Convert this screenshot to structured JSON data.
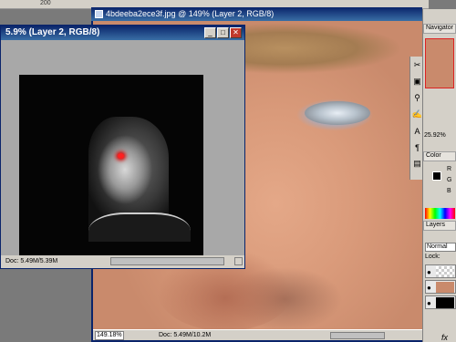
{
  "ruler": {
    "tick_label": "200"
  },
  "big_window": {
    "title": "4bdeeba2ece3f.jpg @ 149% (Layer 2, RGB/8)",
    "zoom": "149.18%",
    "doc_size": "Doc: 5.49M/10.2M"
  },
  "small_window": {
    "title": "5.9% (Layer 2, RGB/8)",
    "doc_size": "Doc: 5.49M/5.39M",
    "minimize": "_",
    "maximize": "□",
    "close": "✕"
  },
  "tools": [
    "move-tool",
    "lasso-tool",
    "brush-tool",
    "stamp-tool",
    "eraser-tool",
    "fill-tool",
    "type-tool",
    "shape-tool",
    "eyedropper-tool",
    "zoom-tool"
  ],
  "tool_glyphs": [
    "⊕",
    "✐",
    "✎",
    "⧉",
    "◐",
    "◆",
    "T",
    "▭",
    "✒",
    "🔍"
  ],
  "palettes": {
    "navigator_tab": "Navigator",
    "navigator_zoom": "25.92%",
    "color_tab": "Color",
    "color_channels": [
      "R",
      "G",
      "B"
    ],
    "layers_tab": "Layers",
    "blend_mode": "Normal",
    "lock_label": "Lock:",
    "fx_label": "fx"
  },
  "nav_tools": [
    "✂",
    "▣",
    "⚲",
    "✍",
    "A",
    "¶",
    "▤"
  ],
  "colors": {
    "titlebar": "#0a246a",
    "panel": "#d4d0c8",
    "canvas": "#a8a8a8",
    "red_eye": "#ff2020"
  }
}
